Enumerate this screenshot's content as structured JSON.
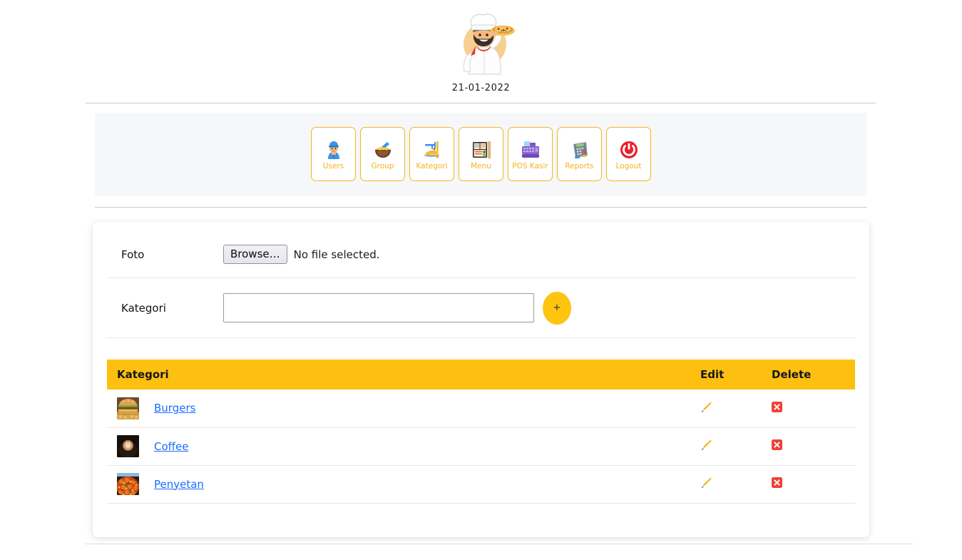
{
  "header": {
    "logo_icon": "chef-with-pizza-logo",
    "date": "21-01-2022"
  },
  "nav": {
    "items": [
      {
        "label": "Users",
        "icon": "worker-chef-icon"
      },
      {
        "label": "Group",
        "icon": "bowl-with-spoon-icon"
      },
      {
        "label": "Kategori",
        "icon": "spaghetti-fork-icon"
      },
      {
        "label": "Menu",
        "icon": "bento-box-icon"
      },
      {
        "label": "POS Kasir",
        "icon": "cash-register-icon"
      },
      {
        "label": "Reports",
        "icon": "calculator-terminal-icon"
      },
      {
        "label": "Logout",
        "icon": "power-off-icon"
      }
    ]
  },
  "form": {
    "foto": {
      "label": "Foto",
      "browse_label": "Browse…",
      "file_status": "No file selected."
    },
    "kategori": {
      "label": "Kategori",
      "value": "",
      "placeholder": "",
      "add_label": "+"
    }
  },
  "table": {
    "columns": [
      "Kategori",
      "Edit",
      "Delete"
    ],
    "rows": [
      {
        "name": "Burgers",
        "thumb": "burger-photo-thumbnail",
        "edit_icon": "pencil-icon",
        "delete_icon": "red-x-icon"
      },
      {
        "name": "Coffee",
        "thumb": "latte-coffee-photo-thumbnail",
        "edit_icon": "pencil-icon",
        "delete_icon": "red-x-icon"
      },
      {
        "name": "Penyetan",
        "thumb": "spicy-rice-photo-thumbnail",
        "edit_icon": "pencil-icon",
        "delete_icon": "red-x-icon"
      }
    ]
  },
  "colors": {
    "accent_yellow": "#fdc010",
    "nav_border": "#f0b91e",
    "nav_label": "#f5b21e",
    "panel_bg": "#f6f7f9",
    "link_blue": "#1a6dff",
    "delete_red": "#ef4136",
    "plus_bg": "#ffc40d"
  }
}
